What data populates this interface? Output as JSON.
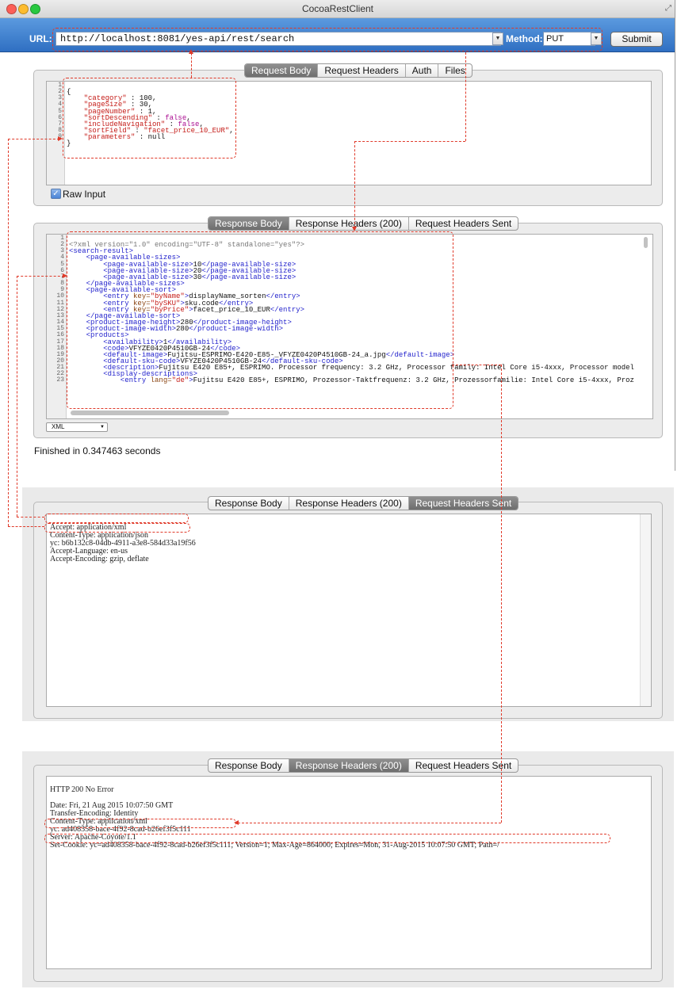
{
  "window": {
    "title": "CocoaRestClient"
  },
  "toolbar": {
    "url_label": "URL:",
    "url_value": "http://localhost:8081/yes-api/rest/search",
    "method_label": "Method:",
    "method_value": "PUT",
    "submit_label": "Submit"
  },
  "request": {
    "tabs": [
      "Request Body",
      "Request Headers",
      "Auth",
      "Files"
    ],
    "selected_tab": "Request Body",
    "lines": [
      "1",
      "2",
      "3",
      "4",
      "5",
      "6",
      "7",
      "8",
      "9"
    ],
    "body": {
      "open": "{",
      "category_key": "\"category\"",
      "category_val": " : 100,",
      "pagesize_key": "\"pageSize\"",
      "pagesize_val": " : 30,",
      "pagenumber_key": "\"pageNumber\"",
      "pagenumber_val": " : 1,",
      "sortdesc_key": "\"sortDescending\"",
      "sortdesc_sep": " : ",
      "sortdesc_val": "false",
      "sortdesc_end": ",",
      "includenav_key": "\"includeNavigation\"",
      "includenav_sep": " : ",
      "includenav_val": "false",
      "includenav_end": ",",
      "sortfield_key": "\"sortField\"",
      "sortfield_sep": " : ",
      "sortfield_val": "\"facet_price_10_EUR\"",
      "sortfield_end": ",",
      "params_key": "\"parameters\"",
      "params_val": " : null",
      "close": "}"
    },
    "raw_input_label": "Raw Input",
    "raw_input_checked": true
  },
  "response": {
    "tabs": [
      "Response Body",
      "Response Headers (200)",
      "Request Headers Sent"
    ],
    "selected_tab": "Response Body",
    "lines": [
      "1",
      "2",
      "3",
      "4",
      "5",
      "6",
      "7",
      "8",
      "9",
      "10",
      "11",
      "12",
      "13",
      "14",
      "15",
      "16",
      "17",
      "18",
      "19",
      "20",
      "21",
      "22",
      "23"
    ],
    "xml": {
      "l1": "<?xml version=\"1.0\" encoding=\"UTF-8\" standalone=\"yes\"?>",
      "l2": "<search-result>",
      "l3": "    <page-available-sizes>",
      "l4a": "        <page-available-size>",
      "l4b": "10",
      "l4c": "</page-available-size>",
      "l5a": "        <page-available-size>",
      "l5b": "20",
      "l5c": "</page-available-size>",
      "l6a": "        <page-available-size>",
      "l6b": "30",
      "l6c": "</page-available-size>",
      "l7": "    </page-available-sizes>",
      "l8": "    <page-available-sort>",
      "l9a": "        <entry ",
      "l9k": "key=",
      "l9v": "\"byName\"",
      "l9b": ">",
      "l9t": "displayName_sorten",
      "l9c": "</entry>",
      "l10a": "        <entry ",
      "l10k": "key=",
      "l10v": "\"bySKU\"",
      "l10b": ">",
      "l10t": "sku.code",
      "l10c": "</entry>",
      "l11a": "        <entry ",
      "l11k": "key=",
      "l11v": "\"byPrice\"",
      "l11b": ">",
      "l11t": "facet_price_10_EUR",
      "l11c": "</entry>",
      "l12": "    </page-available-sort>",
      "l13a": "    <product-image-height>",
      "l13b": "280",
      "l13c": "</product-image-height>",
      "l14a": "    <product-image-width>",
      "l14b": "280",
      "l14c": "</product-image-width>",
      "l15": "    <products>",
      "l16a": "        <availability>",
      "l16b": "1",
      "l16c": "</availability>",
      "l17a": "        <code>",
      "l17b": "VFYZE0420P4510GB-24",
      "l17c": "</code>",
      "l18a": "        <default-image>",
      "l18b": "Fujitsu-ESPRIMO-E420-E85-_VFYZE0420P4510GB-24_a.jpg",
      "l18c": "</default-image>",
      "l19a": "        <default-sku-code>",
      "l19b": "VFYZE0420P4510GB-24",
      "l19c": "</default-sku-code>",
      "l20a": "        <description>",
      "l20b": "Fujitsu E420 E85+, ESPRIMO. Processor frequency: 3.2 GHz, Processor family: Intel Core i5-4xxx, Processor model",
      "l21": "        <display-descriptions>",
      "l22a": "            <entry ",
      "l22k": "lang=",
      "l22v": "\"de\"",
      "l22b": ">",
      "l22t": "Fujitsu E420 E85+, ESPRIMO, Prozessor-Taktfrequenz: 3.2 GHz, Prozessorfamilie: Intel Core i5-4xxx, Proz"
    },
    "format_value": "XML"
  },
  "status_text": "Finished in 0.347463 seconds",
  "panel_sent": {
    "tabs": [
      "Response Body",
      "Response Headers (200)",
      "Request Headers Sent"
    ],
    "selected_tab": "Request Headers Sent",
    "lines": [
      "Accept: application/xml",
      "Content-Type: application/json",
      "yc: b6b132c8-04db-4911-a3e8-584d33a19f56",
      "Accept-Language: en-us",
      "Accept-Encoding: gzip, deflate"
    ]
  },
  "panel_headers": {
    "tabs": [
      "Response Body",
      "Response Headers (200)",
      "Request Headers Sent"
    ],
    "selected_tab": "Response Headers (200)",
    "lines": [
      "HTTP 200 No Error",
      "",
      "Date: Fri, 21 Aug 2015 10:07:50 GMT",
      "Transfer-Encoding: Identity",
      "Content-Type: application/xml",
      "yc: ad408358-bace-4f92-8cad-b26ef3f5c111",
      "Server: Apache-Coyote/1.1",
      "Set-Cookie: yc=ad408358-bace-4f92-8cad-b26ef3f5c111; Version=1; Max-Age=864000; Expires=Mon, 31-Aug-2015 10:07:50 GMT; Path=/"
    ]
  }
}
